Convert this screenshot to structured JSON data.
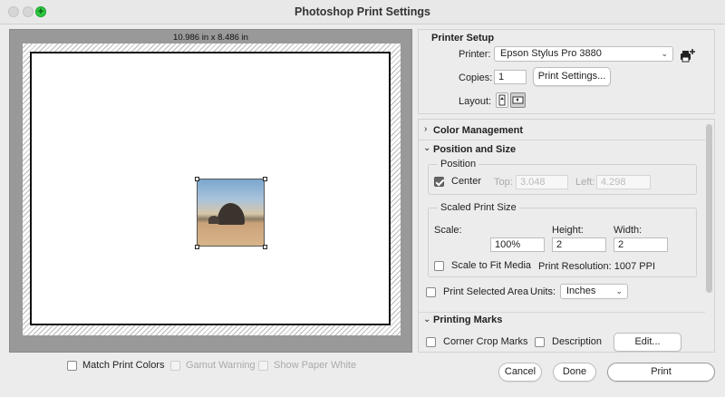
{
  "window": {
    "title": "Photoshop Print Settings"
  },
  "preview": {
    "size_label": "10.986 in x 8.486 in"
  },
  "preview_options": {
    "match_print_colors": "Match Print Colors",
    "gamut_warning": "Gamut Warning",
    "show_paper_white": "Show Paper White"
  },
  "printer_setup": {
    "title": "Printer Setup",
    "printer_label": "Printer:",
    "printer_value": "Epson Stylus Pro 3880",
    "copies_label": "Copies:",
    "copies_value": "1",
    "print_settings_button": "Print Settings...",
    "layout_label": "Layout:"
  },
  "color_management": {
    "title": "Color Management"
  },
  "position_and_size": {
    "title": "Position and Size",
    "position_group": "Position",
    "center_label": "Center",
    "top_label": "Top:",
    "top_value": "3.048",
    "left_label": "Left:",
    "left_value": "4.298",
    "scaled_group": "Scaled Print Size",
    "scale_label": "Scale:",
    "scale_value": "100%",
    "height_label": "Height:",
    "height_value": "2",
    "width_label": "Width:",
    "width_value": "2",
    "scale_to_fit": "Scale to Fit Media",
    "print_resolution": "Print Resolution: 1007 PPI",
    "print_selected_area": "Print Selected Area",
    "units_label": "Units:",
    "units_value": "Inches"
  },
  "printing_marks": {
    "title": "Printing Marks",
    "corner_crop_marks": "Corner Crop Marks",
    "description": "Description",
    "edit_button": "Edit..."
  },
  "footer": {
    "cancel": "Cancel",
    "done": "Done",
    "print": "Print"
  },
  "icons": {
    "add_printer": "add-printer-icon",
    "portrait": "portrait-layout-icon",
    "landscape": "landscape-layout-icon"
  }
}
